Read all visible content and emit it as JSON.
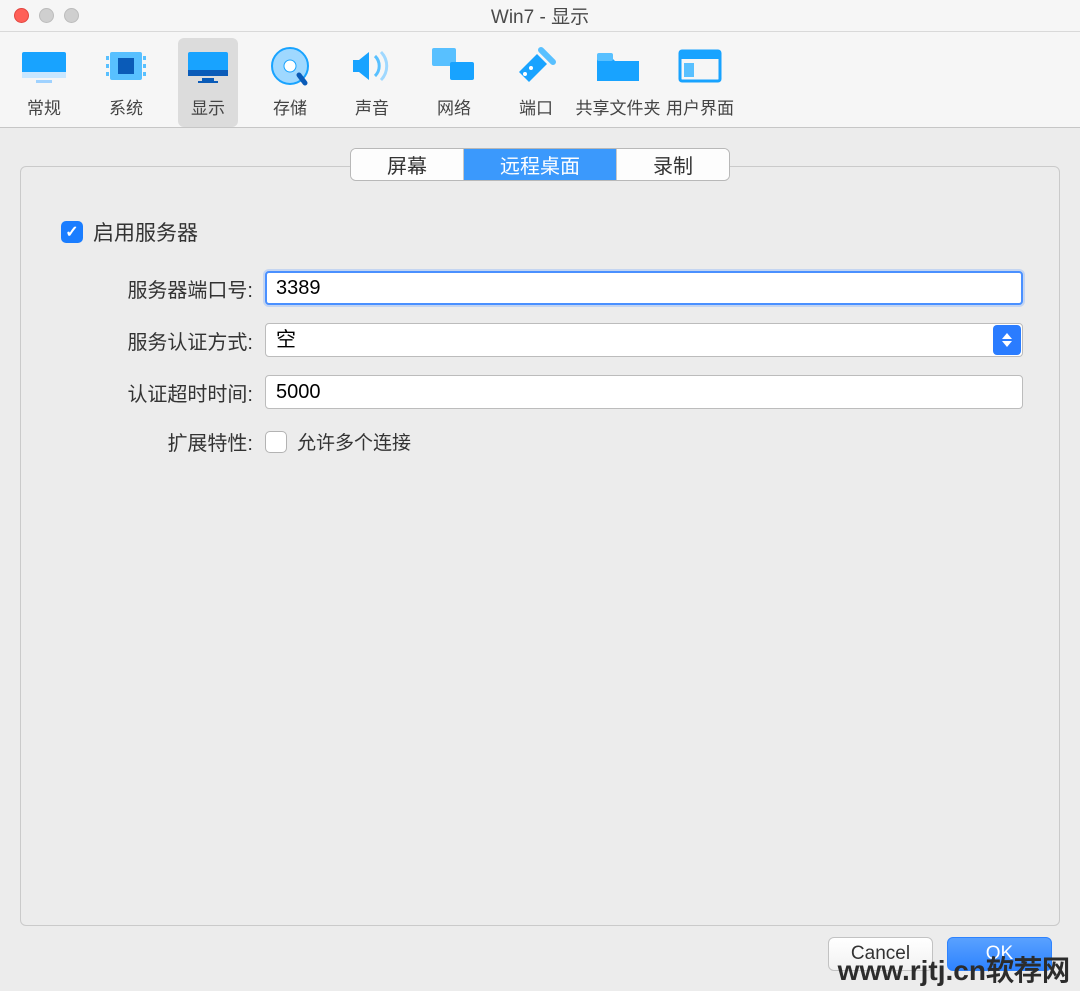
{
  "window": {
    "title": "Win7 - 显示"
  },
  "toolbar": {
    "items": [
      {
        "id": "general",
        "label": "常规"
      },
      {
        "id": "system",
        "label": "系统"
      },
      {
        "id": "display",
        "label": "显示",
        "active": true
      },
      {
        "id": "storage",
        "label": "存储"
      },
      {
        "id": "audio",
        "label": "声音"
      },
      {
        "id": "network",
        "label": "网络"
      },
      {
        "id": "ports",
        "label": "端口"
      },
      {
        "id": "shared",
        "label": "共享文件夹"
      },
      {
        "id": "ui",
        "label": "用户界面"
      }
    ]
  },
  "tabs": {
    "items": [
      {
        "id": "screen",
        "label": "屏幕"
      },
      {
        "id": "remote",
        "label": "远程桌面",
        "active": true
      },
      {
        "id": "record",
        "label": "录制"
      }
    ]
  },
  "form": {
    "enable_label": "启用服务器",
    "enable_checked": true,
    "port_label": "服务器端口号:",
    "port_value": "3389",
    "auth_label": "服务认证方式:",
    "auth_value": "空",
    "timeout_label": "认证超时时间:",
    "timeout_value": "5000",
    "ext_label": "扩展特性:",
    "multi_label": "允许多个连接",
    "multi_checked": false
  },
  "footer": {
    "cancel": "Cancel",
    "ok": "OK"
  },
  "watermark": "www.rjtj.cn软荐网"
}
